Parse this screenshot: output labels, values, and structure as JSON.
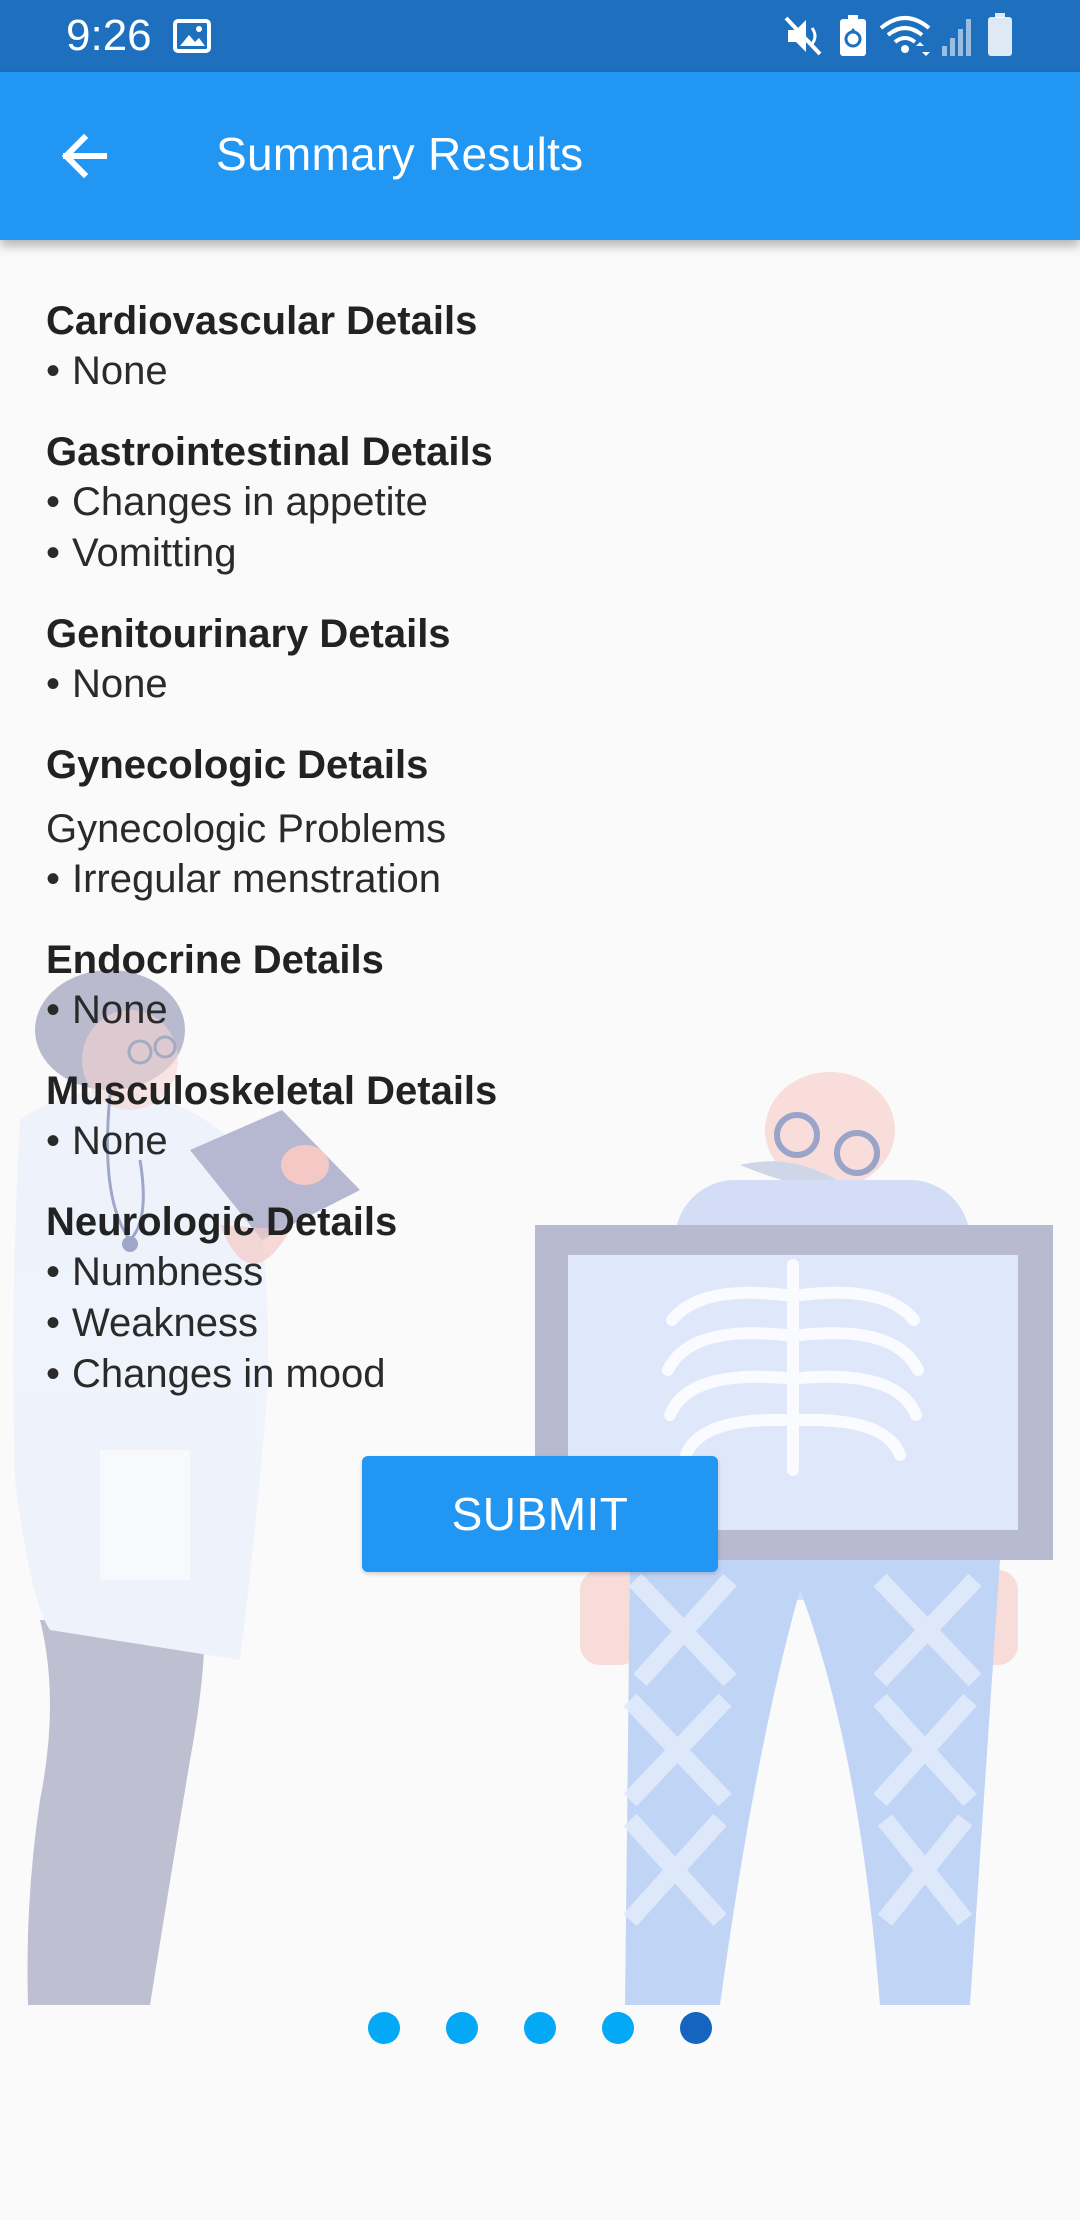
{
  "status_bar": {
    "time": "9:26",
    "left_icons": [
      "image-icon"
    ],
    "right_icons": [
      "mute-icon",
      "battery-saver-icon",
      "wifi-icon",
      "signal-icon",
      "battery-icon"
    ],
    "background": "#1e70bf"
  },
  "app_bar": {
    "title": "Summary Results",
    "back_icon": "arrow-back-icon",
    "background": "#2196f3"
  },
  "sections": [
    {
      "title": "Cardiovascular Details",
      "items": [
        "None"
      ]
    },
    {
      "title": "Gastrointestinal Details",
      "items": [
        "Changes in appetite",
        "Vomitting"
      ]
    },
    {
      "title": "Genitourinary Details",
      "items": [
        "None"
      ]
    },
    {
      "title": "Gynecologic Details",
      "subheading": "Gynecologic Problems",
      "items": [
        "Irregular menstration"
      ]
    },
    {
      "title": "Endocrine Details",
      "items": [
        "None"
      ]
    },
    {
      "title": "Musculoskeletal Details",
      "items": [
        "None"
      ]
    },
    {
      "title": "Neurologic Details",
      "items": [
        "Numbness",
        "Weakness",
        "Changes in mood"
      ]
    }
  ],
  "bullet": "•",
  "submit_button": {
    "label": "SUBMIT"
  },
  "pagination": {
    "total": 5,
    "active_index": 4,
    "dot_color": "#03a9f4",
    "active_color": "#1565c0"
  },
  "illustration": {
    "subjects": [
      "doctor-holding-clipboard",
      "patient-with-chest-xray"
    ]
  },
  "colors": {
    "primary": "#2196f3",
    "status_bar": "#1e70bf",
    "background": "#fafafa",
    "text": "#222222"
  }
}
